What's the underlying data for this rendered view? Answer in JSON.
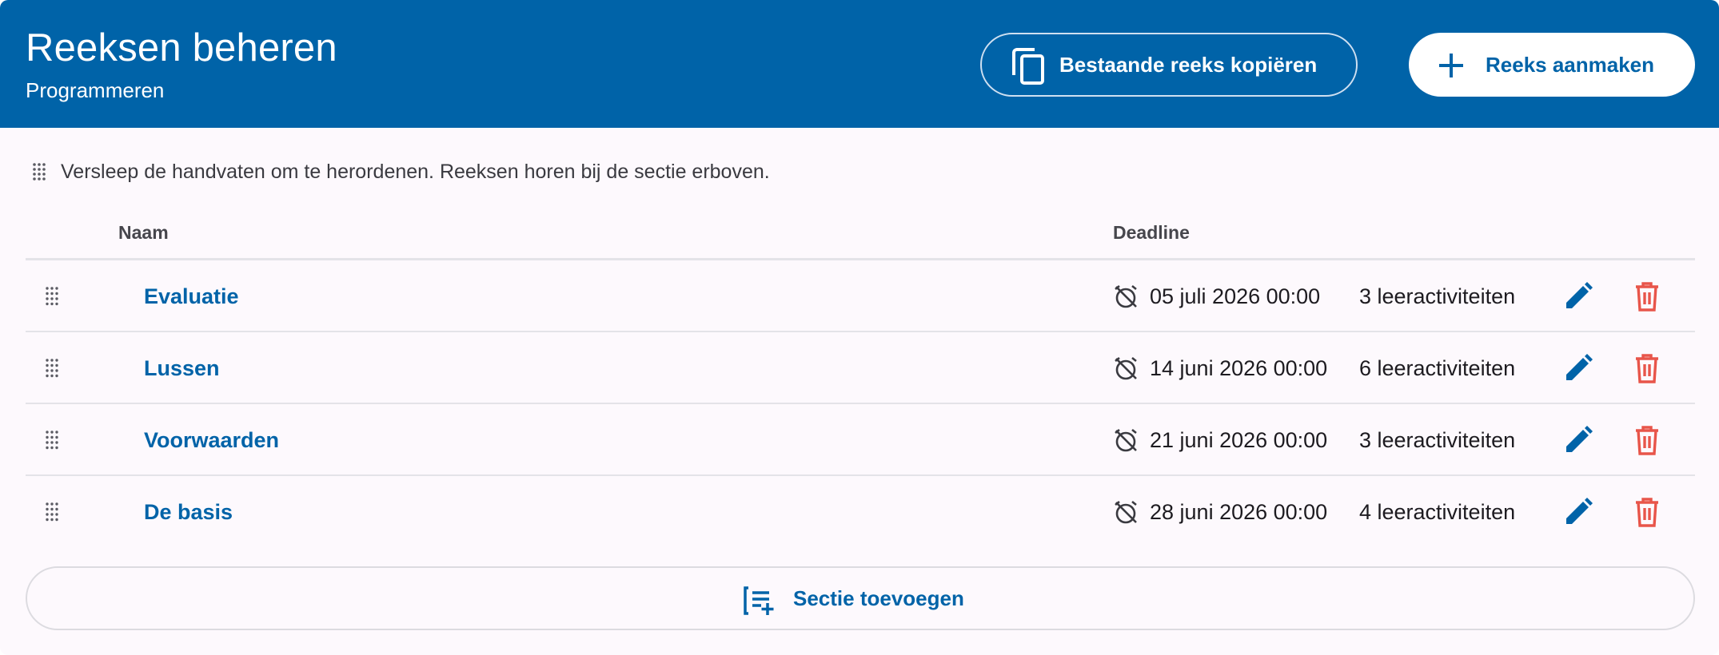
{
  "header": {
    "title": "Reeksen beheren",
    "subtitle": "Programmeren",
    "copy_button_label": "Bestaande reeks kopiëren",
    "create_button_label": "Reeks aanmaken"
  },
  "hint": {
    "text": "Versleep de handvaten om te herordenen. Reeksen horen bij de sectie erboven."
  },
  "table": {
    "columns": {
      "name": "Naam",
      "deadline": "Deadline"
    },
    "rows": [
      {
        "name": "Evaluatie",
        "deadline": "05 juli 2026 00:00",
        "activities": "3 leeractiviteiten"
      },
      {
        "name": "Lussen",
        "deadline": "14 juni 2026 00:00",
        "activities": "6 leeractiviteiten"
      },
      {
        "name": "Voorwaarden",
        "deadline": "21 juni 2026 00:00",
        "activities": "3 leeractiviteiten"
      },
      {
        "name": "De basis",
        "deadline": "28 juni 2026 00:00",
        "activities": "4 leeractiviteiten"
      }
    ]
  },
  "add_section": {
    "label": "Sectie toevoegen"
  },
  "icons": {
    "copy": "content-copy-icon",
    "add": "plus-icon",
    "drag": "drag-handle-icon",
    "alarm": "alarm-off-icon",
    "edit": "pencil-icon",
    "delete": "trash-icon",
    "add_section": "playlist-add-icon"
  },
  "colors": {
    "primary": "#0063a8",
    "danger": "#e8554a",
    "background": "#fdf9fd"
  }
}
